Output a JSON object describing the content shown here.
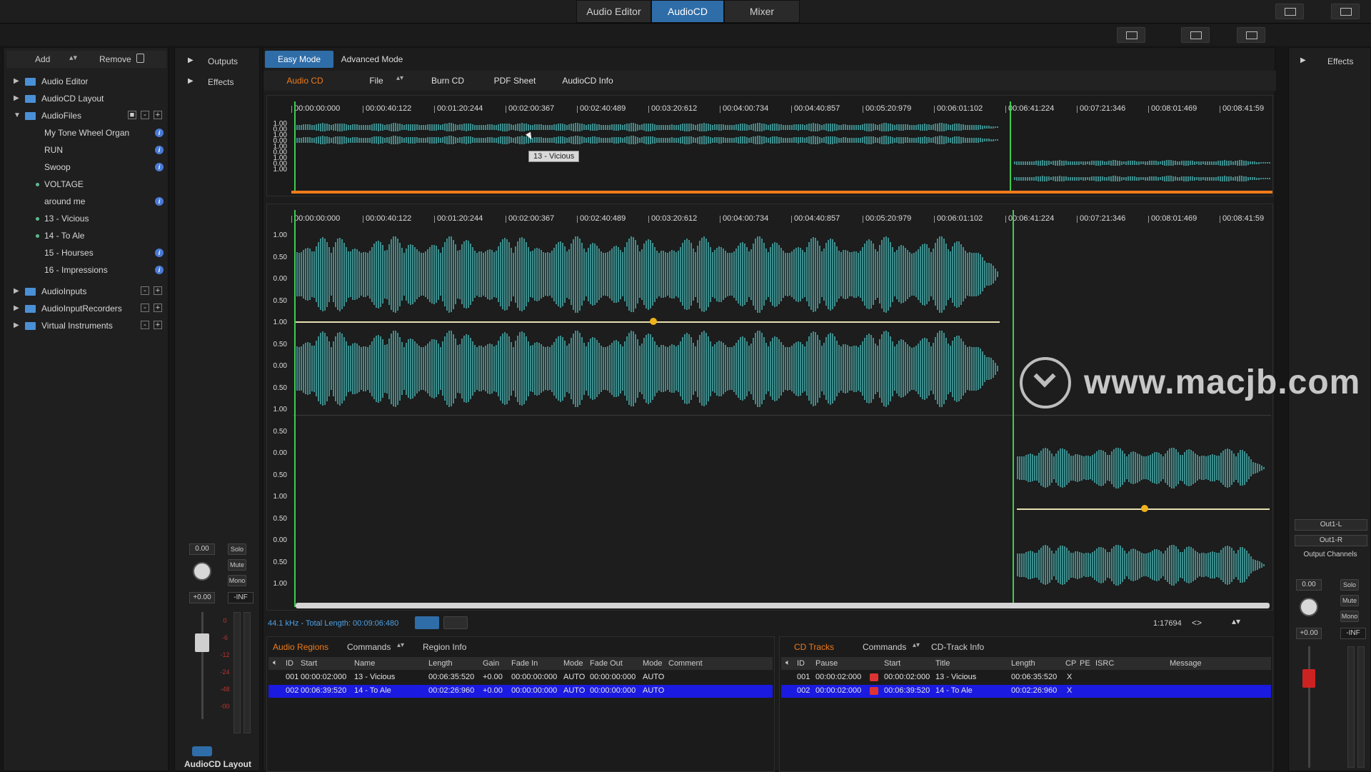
{
  "top_tabs": [
    "Audio Editor",
    "AudioCD",
    "Mixer"
  ],
  "active_tab": "AudioCD",
  "left_panel": {
    "add_label": "Add",
    "remove_label": "Remove",
    "folders": [
      {
        "label": "Audio Editor"
      },
      {
        "label": "AudioCD Layout"
      },
      {
        "label": "AudioFiles"
      },
      {
        "label": "AudioInputs"
      },
      {
        "label": "AudioInputRecorders"
      },
      {
        "label": "Virtual Instruments"
      }
    ],
    "files": [
      {
        "label": "My Tone Wheel Organ"
      },
      {
        "label": "RUN"
      },
      {
        "label": "Swoop"
      },
      {
        "label": "VOLTAGE"
      },
      {
        "label": "around me"
      },
      {
        "label": "13 - Vicious"
      },
      {
        "label": "14 - To Ale"
      },
      {
        "label": "15 - Hourses"
      },
      {
        "label": "16 - Impressions"
      }
    ]
  },
  "side_panel": {
    "outputs_label": "Outputs",
    "effects_label": "Effects",
    "volume_value": "0.00",
    "pan_value": "+0.00",
    "peak_value": "-INF",
    "solo": "Solo",
    "mute": "Mute",
    "mono": "Mono",
    "channel_name": "AudioCD Layout",
    "meter_scale": [
      "0",
      "-6",
      "-12",
      "-24",
      "-48",
      "-00"
    ]
  },
  "mode_tabs": {
    "easy": "Easy Mode",
    "advanced": "Advanced Mode"
  },
  "toolbar": {
    "audio_cd": "Audio CD",
    "file": "File",
    "burn_cd": "Burn CD",
    "pdf_sheet": "PDF Sheet",
    "audiocd_info": "AudioCD Info"
  },
  "ruler": [
    "00:00:00:000",
    "00:00:40:122",
    "00:01:20:244",
    "00:02:00:367",
    "00:02:40:489",
    "00:03:20:612",
    "00:04:00:734",
    "00:04:40:857",
    "00:05:20:979",
    "00:06:01:102",
    "00:06:41:224",
    "00:07:21:346",
    "00:08:01:469",
    "00:08:41:59"
  ],
  "overview_ylabels": [
    "1.00",
    "0.00",
    "1.00",
    "0.00",
    "1.00",
    "0.00",
    "1.00",
    "0.00",
    "1.00"
  ],
  "main_ylabels": [
    "1.00",
    "0.50",
    "0.00",
    "0.50",
    "1.00",
    "0.50",
    "0.00",
    "0.50",
    "1.00",
    "0.50",
    "0.00",
    "0.50",
    "1.00",
    "0.50",
    "0.00",
    "0.50",
    "1.00"
  ],
  "tooltip": "13 - Vicious",
  "watermark": "www.macjb.com",
  "status": {
    "info": "44.1 kHz - Total Length: 00:09:06:480",
    "zoom": "1:17694"
  },
  "regions": {
    "tab": "Audio Regions",
    "commands": "Commands",
    "info": "Region Info",
    "columns": [
      "ID",
      "Start",
      "Name",
      "Length",
      "Gain",
      "Fade In",
      "Mode",
      "Fade Out",
      "Mode",
      "Comment"
    ],
    "rows": [
      [
        "001",
        "00:00:02:000",
        "13 - Vicious",
        "00:06:35:520",
        "+0.00",
        "00:00:00:000",
        "AUTO",
        "00:00:00:000",
        "AUTO",
        ""
      ],
      [
        "002",
        "00:06:39:520",
        "14 - To Ale",
        "00:02:26:960",
        "+0.00",
        "00:00:00:000",
        "AUTO",
        "00:00:00:000",
        "AUTO",
        ""
      ]
    ]
  },
  "cd_tracks": {
    "tab": "CD Tracks",
    "commands": "Commands",
    "info": "CD-Track Info",
    "columns": [
      "ID",
      "Pause",
      "Start",
      "Title",
      "Length",
      "CP",
      "PE",
      "ISRC",
      "Message"
    ],
    "rows": [
      [
        "001",
        "00:00:02:000",
        "00:00:02:000",
        "13 - Vicious",
        "00:06:35:520",
        "X",
        "",
        "",
        ""
      ],
      [
        "002",
        "00:00:02:000",
        "00:06:39:520",
        "14 - To Ale",
        "00:02:26:960",
        "X",
        "",
        "",
        ""
      ]
    ]
  },
  "right_panel": {
    "effects_label": "Effects",
    "out_l": "Out1-L",
    "out_r": "Out1-R",
    "output_channels": "Output Channels",
    "volume_value": "0.00",
    "pan_value": "+0.00",
    "peak_value": "-INF",
    "solo": "Solo",
    "mute": "Mute",
    "mono": "Mono"
  },
  "colors": {
    "accent": "#2f6da8",
    "waveform": "#3f8c8c",
    "selection": "#1a1ae0",
    "marker": "#3fcc4f",
    "orange": "#f07a1a"
  }
}
